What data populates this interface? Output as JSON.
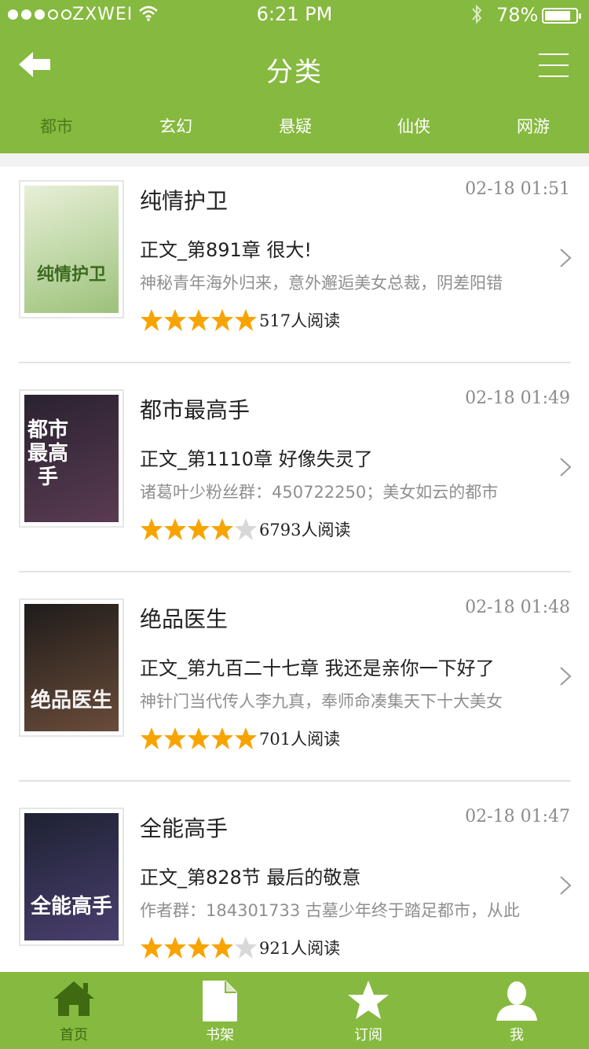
{
  "status_bar": {
    "carrier": "ZXWEI",
    "time": "6:21 PM",
    "battery": "78%"
  },
  "navbar": {
    "title": "分类",
    "back_icon": "back-arrow-icon",
    "menu_icon": "hamburger-menu-icon"
  },
  "categories": [
    {
      "label": "都市",
      "active": true
    },
    {
      "label": "玄幻",
      "active": false
    },
    {
      "label": "悬疑",
      "active": false
    },
    {
      "label": "仙侠",
      "active": false
    },
    {
      "label": "网游",
      "active": false
    }
  ],
  "books": [
    {
      "title": "纯情护卫",
      "updated": "02-18 01:51",
      "chapter": "正文_第891章 很大!",
      "description": "神秘青年海外归来，意外邂逅美女总裁，阴差阳错",
      "rating": 5,
      "reads": "517人阅读",
      "cover_text": "纯情护卫",
      "cover_colors": [
        "#e8efd8",
        "#9cc27a"
      ]
    },
    {
      "title": "都市最高手",
      "updated": "02-18 01:49",
      "chapter": "正文_第1110章 好像失灵了",
      "description": "诸葛叶少粉丝群：450722250；美女如云的都市",
      "rating": 4,
      "reads": "6793人阅读",
      "cover_text": "都市最高手",
      "cover_colors": [
        "#2a2230",
        "#5a3b52"
      ]
    },
    {
      "title": "绝品医生",
      "updated": "02-18 01:48",
      "chapter": "正文_第九百二十七章 我还是亲你一下好了",
      "description": "神针门当代传人李九真，奉师命凑集天下十大美女",
      "rating": 5,
      "reads": "701人阅读",
      "cover_text": "绝品医生",
      "cover_colors": [
        "#1f1c1a",
        "#6a4c3a"
      ]
    },
    {
      "title": "全能高手",
      "updated": "02-18 01:47",
      "chapter": "正文_第828节 最后的敬意",
      "description": "作者群：184301733 古墓少年终于踏足都市，从此",
      "rating": 4,
      "reads": "921人阅读",
      "cover_text": "全能高手",
      "cover_colors": [
        "#1d2233",
        "#4a3f6e"
      ]
    }
  ],
  "tabbar": [
    {
      "label": "首页",
      "icon": "home-icon",
      "active": true
    },
    {
      "label": "书架",
      "icon": "bookshelf-icon",
      "active": false
    },
    {
      "label": "订阅",
      "icon": "star-icon",
      "active": false
    },
    {
      "label": "我",
      "icon": "user-icon",
      "active": false
    }
  ],
  "colors": {
    "brand_green": "#86b93f",
    "active_category": "#4e7a1c",
    "star_filled": "#f7a400",
    "star_empty": "#d8d8d8"
  }
}
